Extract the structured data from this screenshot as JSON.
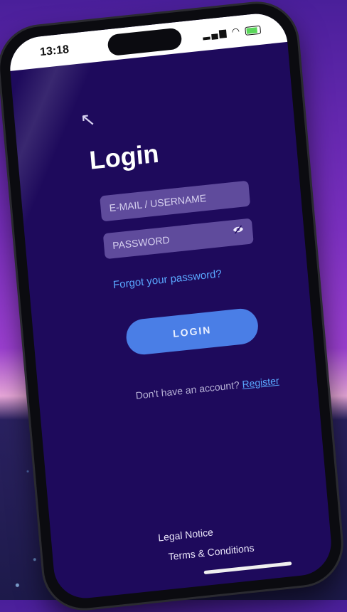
{
  "status_bar": {
    "time": "13:18"
  },
  "login": {
    "title": "Login",
    "email_placeholder": "E-MAIL / USERNAME",
    "password_placeholder": "PASSWORD",
    "forgot_password": "Forgot your password?",
    "login_button": "LOGIN",
    "no_account_text": "Don't have an account?",
    "register_link": " Register"
  },
  "footer": {
    "legal_notice": "Legal Notice",
    "terms": "Terms & Conditions"
  },
  "icons": {
    "back": "arrow-up-left-icon",
    "eye": "eye-icon"
  },
  "colors": {
    "screen_bg": "#1e0a5c",
    "accent_button": "#4a7ee6",
    "link": "#5aa8ff"
  }
}
